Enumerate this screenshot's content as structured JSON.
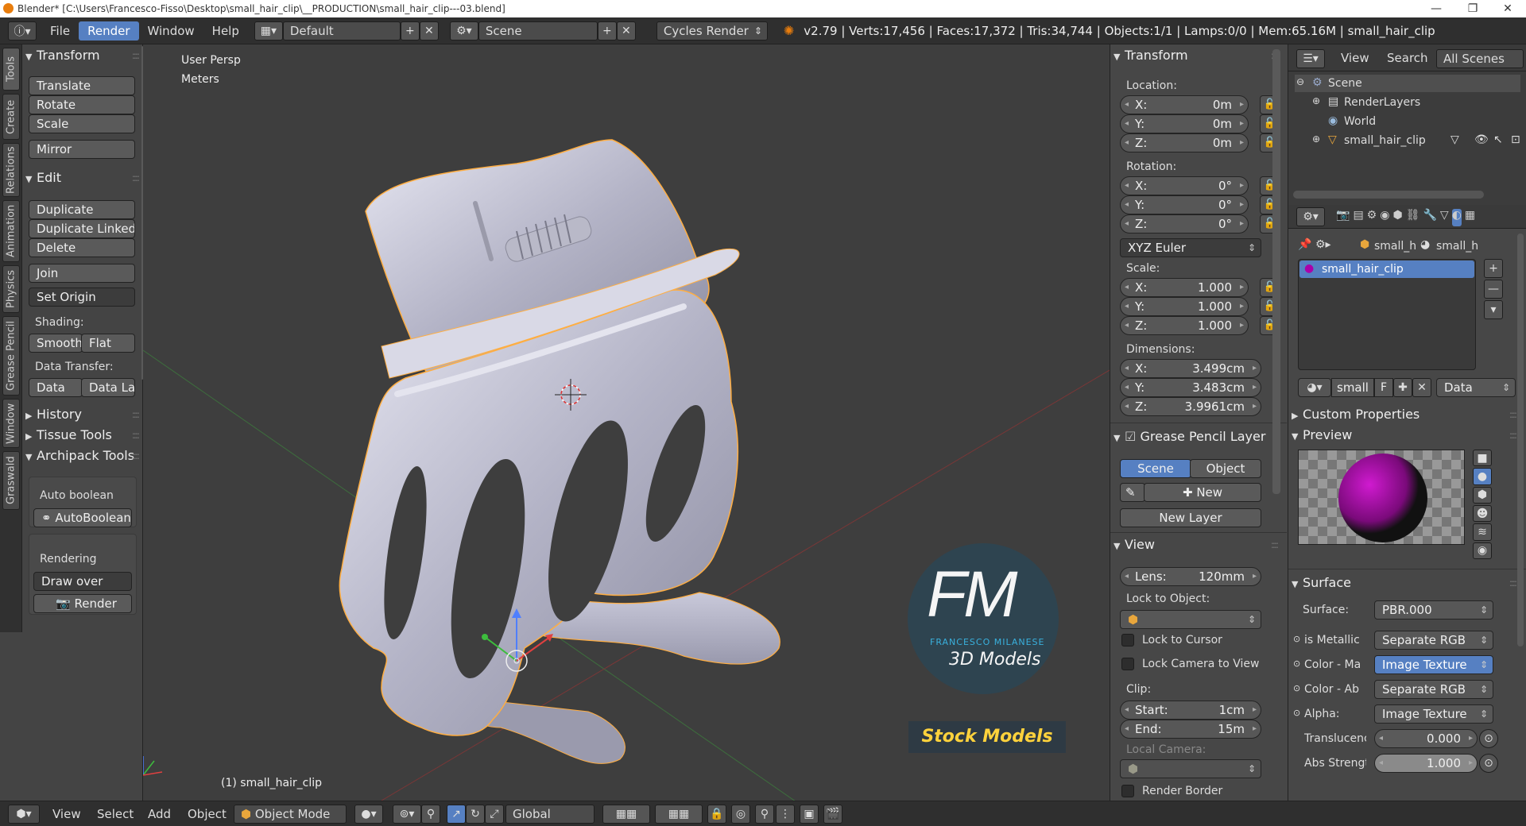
{
  "window": {
    "title": "Blender* [C:\\Users\\Francesco-Fisso\\Desktop\\small_hair_clip\\__PRODUCTION\\small_hair_clip---03.blend]",
    "minimize": "—",
    "maximize": "❐",
    "close": "✕"
  },
  "topbar": {
    "menus": [
      "File",
      "Render",
      "Window",
      "Help"
    ],
    "active_menu": "Render",
    "layout": "Default",
    "scene": "Scene",
    "engine": "Cycles Render",
    "stats": "v2.79 | Verts:17,456 | Faces:17,372 | Tris:34,744 | Objects:1/1 | Lamps:0/0 | Mem:65.16M | small_hair_clip"
  },
  "tool_tabs": [
    "Tools",
    "Create",
    "Relations",
    "Animation",
    "Physics",
    "Grease Pencil",
    "Window",
    "Graswald"
  ],
  "toolshelf": {
    "transform_header": "Transform",
    "translate": "Translate",
    "rotate": "Rotate",
    "scale": "Scale",
    "mirror": "Mirror",
    "edit_header": "Edit",
    "duplicate": "Duplicate",
    "duplicate_linked": "Duplicate Linked",
    "delete": "Delete",
    "join": "Join",
    "set_origin": "Set Origin",
    "shading_label": "Shading:",
    "smooth": "Smooth",
    "flat": "Flat",
    "data_transfer_label": "Data Transfer:",
    "data": "Data",
    "data_la": "Data La",
    "history_header": "History",
    "tissue_header": "Tissue Tools",
    "archipack_header": "Archipack Tools",
    "auto_boolean_label": "Auto boolean",
    "autoboolean_btn": "AutoBoolean",
    "rendering_label": "Rendering",
    "draw_over": "Draw over",
    "render_btn": "Render"
  },
  "viewport": {
    "view_name": "User Persp",
    "units": "Meters",
    "object_label": "(1) small_hair_clip",
    "watermark": {
      "initials": "FM",
      "name": "FRANCESCO MILANESE",
      "tag": "3D Models",
      "stock": "Stock Models"
    }
  },
  "npanel": {
    "transform_header": "Transform",
    "location_label": "Location:",
    "location": [
      {
        "axis": "X:",
        "value": "0m"
      },
      {
        "axis": "Y:",
        "value": "0m"
      },
      {
        "axis": "Z:",
        "value": "0m"
      }
    ],
    "rotation_label": "Rotation:",
    "rotation": [
      {
        "axis": "X:",
        "value": "0°"
      },
      {
        "axis": "Y:",
        "value": "0°"
      },
      {
        "axis": "Z:",
        "value": "0°"
      }
    ],
    "rotation_mode": "XYZ Euler",
    "scale_label": "Scale:",
    "scale": [
      {
        "axis": "X:",
        "value": "1.000"
      },
      {
        "axis": "Y:",
        "value": "1.000"
      },
      {
        "axis": "Z:",
        "value": "1.000"
      }
    ],
    "dimensions_label": "Dimensions:",
    "dimensions": [
      {
        "axis": "X:",
        "value": "3.499cm"
      },
      {
        "axis": "Y:",
        "value": "3.483cm"
      },
      {
        "axis": "Z:",
        "value": "3.9961cm"
      }
    ],
    "grease_header": "Grease Pencil Layer",
    "scene_btn": "Scene",
    "object_btn": "Object",
    "new_btn": "New",
    "new_layer": "New Layer",
    "view_header": "View",
    "lens_label": "Lens:",
    "lens_value": "120mm",
    "lock_object_label": "Lock to Object:",
    "lock_cursor": "Lock to Cursor",
    "lock_camera": "Lock Camera to View",
    "clip_label": "Clip:",
    "clip_start_label": "Start:",
    "clip_start": "1cm",
    "clip_end_label": "End:",
    "clip_end": "15m",
    "local_camera": "Local Camera:",
    "render_border": "Render Border"
  },
  "outliner": {
    "view": "View",
    "search": "Search",
    "filter": "All Scenes",
    "items": [
      "Scene",
      "RenderLayers",
      "World",
      "small_hair_clip"
    ]
  },
  "properties": {
    "crumb1": "small_h",
    "crumb2": "small_h",
    "material_slot": "small_hair_clip",
    "mat_name": "small",
    "mat_f": "F",
    "data_dd": "Data",
    "custom_props": "Custom Properties",
    "preview": "Preview",
    "surface_header": "Surface",
    "surface_label": "Surface:",
    "surface_value": "PBR.000",
    "inputs": [
      {
        "label": "is Metallic",
        "value": "Separate RGB"
      },
      {
        "label": "Color - Ma",
        "value": "Image Texture"
      },
      {
        "label": "Color - Ab",
        "value": "Separate RGB"
      },
      {
        "label": "Alpha:",
        "value": "Image Texture"
      }
    ],
    "translu_label": "Translucence",
    "translu_value": "0.000",
    "abs_label": "Abs Strength",
    "abs_value": "1.000"
  },
  "bottombar": {
    "view": "View",
    "select": "Select",
    "add": "Add",
    "object": "Object",
    "mode": "Object Mode",
    "orientation": "Global"
  }
}
